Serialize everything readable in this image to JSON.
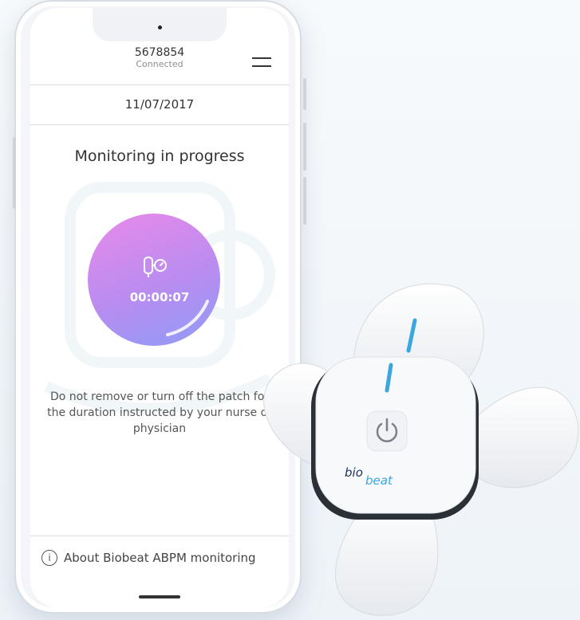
{
  "device": {
    "id": "5678854",
    "status": "Connected"
  },
  "date": "11/07/2017",
  "monitor": {
    "title": "Monitoring in progress",
    "timer": "00:00:07"
  },
  "instructions": "Do not remove or turn off the patch for the duration instructed by your nurse or physician",
  "footer": {
    "about_label": "About Biobeat ABPM monitoring",
    "info_glyph": "i"
  },
  "patch": {
    "brand_prefix": "bio",
    "brand_suffix": "beat"
  },
  "colors": {
    "accent_start": "#e98ae9",
    "accent_end": "#8f9cf6",
    "patch_accent": "#3aa7e0"
  },
  "icons": [
    "menu-icon",
    "blood-pressure-icon",
    "info-icon",
    "power-icon"
  ]
}
